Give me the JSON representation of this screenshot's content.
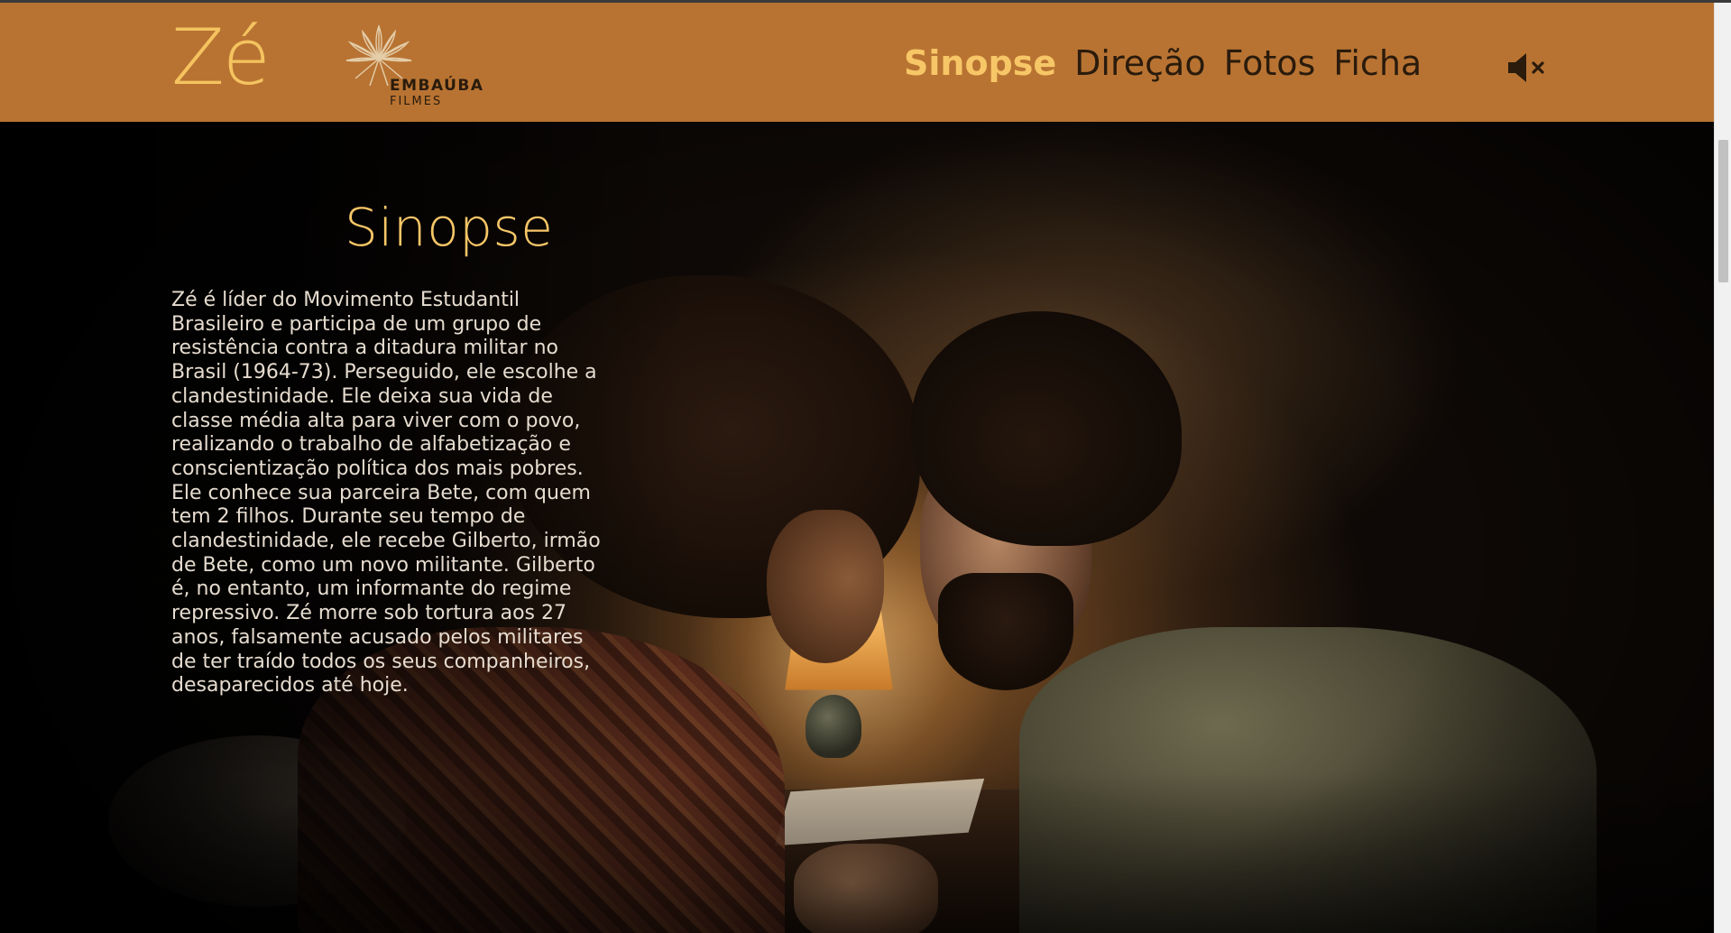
{
  "header": {
    "brand_title": "Zé",
    "logo": {
      "name": "EMBAÚBA",
      "subname": "FILMES",
      "icon": "flower-icon"
    },
    "nav": [
      {
        "label": "Sinopse",
        "active": true
      },
      {
        "label": "Direção",
        "active": false
      },
      {
        "label": "Fotos",
        "active": false
      },
      {
        "label": "Ficha",
        "active": false
      }
    ],
    "sound_icon": "mute-icon"
  },
  "section": {
    "title": "Sinopse",
    "text": "Zé é líder do Movimento Estudantil Brasileiro e participa de um grupo de resistência contra a ditadura militar no Brasil (1964-73). Perseguido, ele escolhe a clandestinidade. Ele deixa sua vida de classe média alta para viver com o povo, realizando o trabalho de alfabetização e conscientização política dos mais pobres. Ele conhece sua parceira Bete, com quem tem 2 filhos. Durante seu tempo de clandestinidade, ele recebe Gilberto, irmão de Bete, como um novo militante. Gilberto é, no entanto, um informante do regime repressivo. Zé morre sob tortura aos 27 anos, falsamente acusado pelos militares de ter traído todos os seus companheiros, desaparecidos até hoje."
  },
  "colors": {
    "header_bg": "#b87332",
    "accent": "#f7c667",
    "nav_text": "#2a1b0c",
    "body_text": "#e6dccf"
  }
}
